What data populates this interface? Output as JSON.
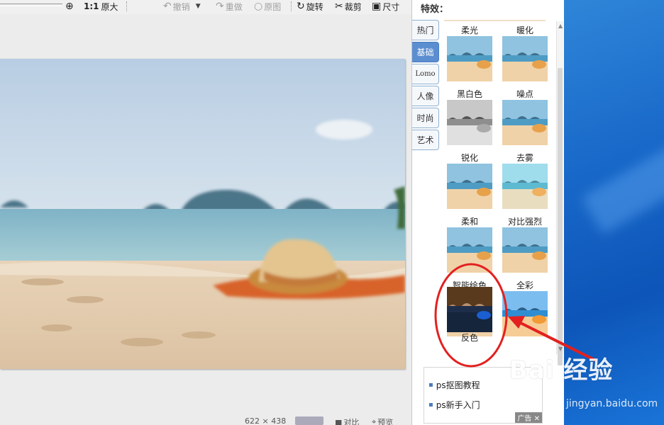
{
  "toolbar": {
    "zoom_icon": "zoom-in-icon",
    "actual_size_label": "1:1",
    "actual_size_text": "原大",
    "undo_label": "撤销",
    "redo_label": "重做",
    "original_label": "原图",
    "rotate_label": "旋转",
    "crop_label": "裁剪",
    "size_label": "尺寸"
  },
  "statusbar": {
    "dimensions": "622 × 438",
    "compare_label": "对比",
    "preview_label": "预览"
  },
  "panel": {
    "title": "特效：",
    "tabs": [
      "热门",
      "基础",
      "Lomo",
      "人像",
      "时尚",
      "艺术"
    ],
    "active_tab": "基础",
    "effects": [
      {
        "label": "柔光",
        "style": "plain"
      },
      {
        "label": "暖化",
        "style": "plain"
      },
      {
        "label": "黑白色",
        "style": "bw"
      },
      {
        "label": "噪点",
        "style": "plain"
      },
      {
        "label": "锐化",
        "style": "plain"
      },
      {
        "label": "去雾",
        "style": "cyan"
      },
      {
        "label": "柔和",
        "style": "plain"
      },
      {
        "label": "对比强烈",
        "style": "plain"
      },
      {
        "label": "智能绘色",
        "style": "plain"
      },
      {
        "label": "全彩",
        "style": "vivid"
      },
      {
        "label": "反色",
        "style": "invert"
      }
    ],
    "links": [
      "ps抠图教程",
      "ps新手入门"
    ],
    "ad_label": "广告"
  },
  "watermark": {
    "main": "Bai 经验",
    "sub": "jingyan.baidu.com"
  },
  "colors": {
    "active_tab": "#5b8ed0",
    "annotation_red": "#e32020",
    "desktop_blue": "#1767c8"
  }
}
